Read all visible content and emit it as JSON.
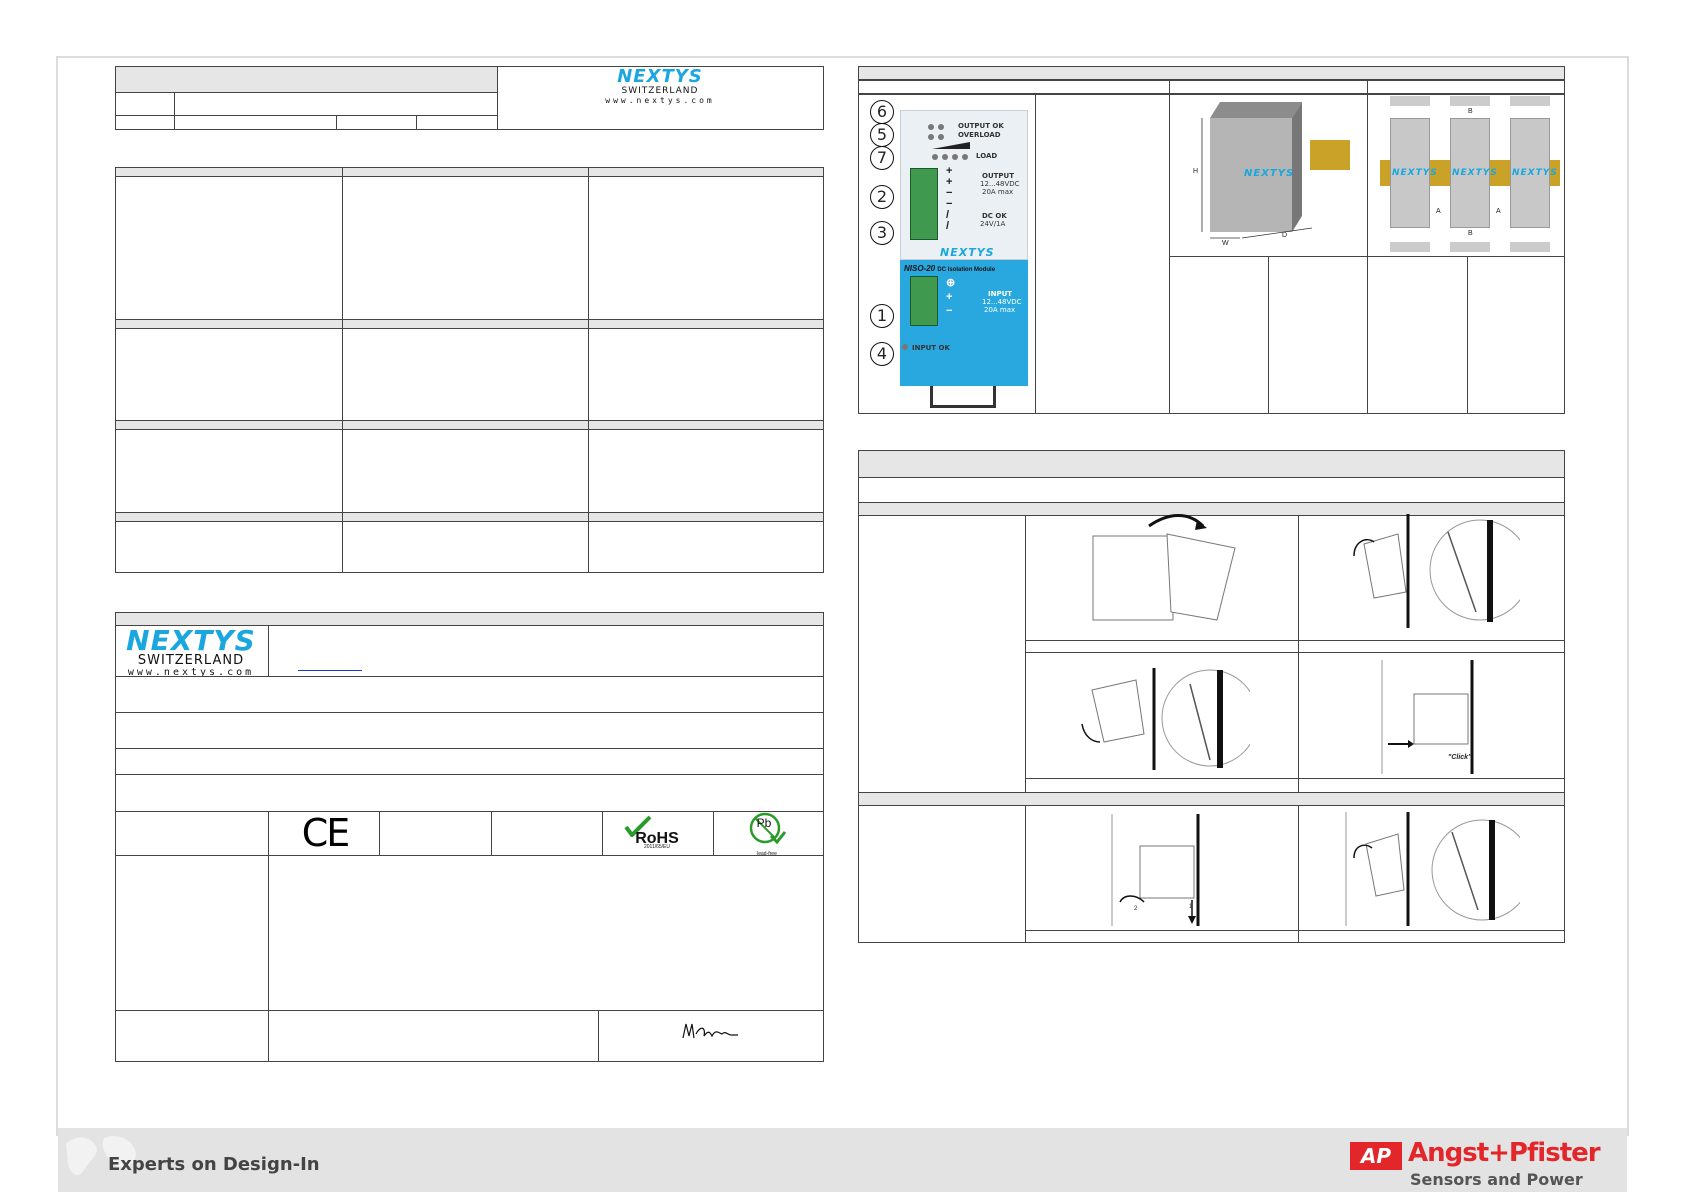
{
  "brand": {
    "logo_text": "NEXTYS",
    "subtitle": "SWITZERLAND",
    "url": "www.nextys.com"
  },
  "product": {
    "model_label": "NISO-20",
    "model_desc": "DC Isolation Module",
    "output_ok": "OUTPUT OK",
    "overload": "OVERLOAD",
    "load": "LOAD",
    "output_title": "OUTPUT",
    "output_range": "12...48VDC",
    "output_max": "20A max",
    "dcok_title": "DC OK",
    "dcok_rating": "24V/1A",
    "input_title": "INPUT",
    "input_range": "12...48VDC",
    "input_max": "20A max",
    "input_ok": "INPUT OK",
    "callouts": [
      "6",
      "5",
      "7",
      "2",
      "3",
      "1",
      "4"
    ]
  },
  "dimensions": {
    "h": "H",
    "w": "W",
    "d": "D",
    "a": "A",
    "b": "B"
  },
  "mounting": {
    "click_label": "\"Click\"",
    "arrow_1": "1",
    "arrow_2": "2"
  },
  "certifications": {
    "ce": "CE",
    "rohs": "RoHS",
    "rohs_sub": "2011/65/EU",
    "pb": "Pb",
    "pb_sub": "lead-free"
  },
  "footer": {
    "tagline": "Experts on Design-In",
    "company": "Angst+Pfister",
    "company_sub": "Sensors and Power",
    "company_mark": "AP"
  },
  "colors": {
    "nextys_blue": "#1aa7e0",
    "ap_red": "#e3262a",
    "module_blue": "#29a8e0"
  }
}
